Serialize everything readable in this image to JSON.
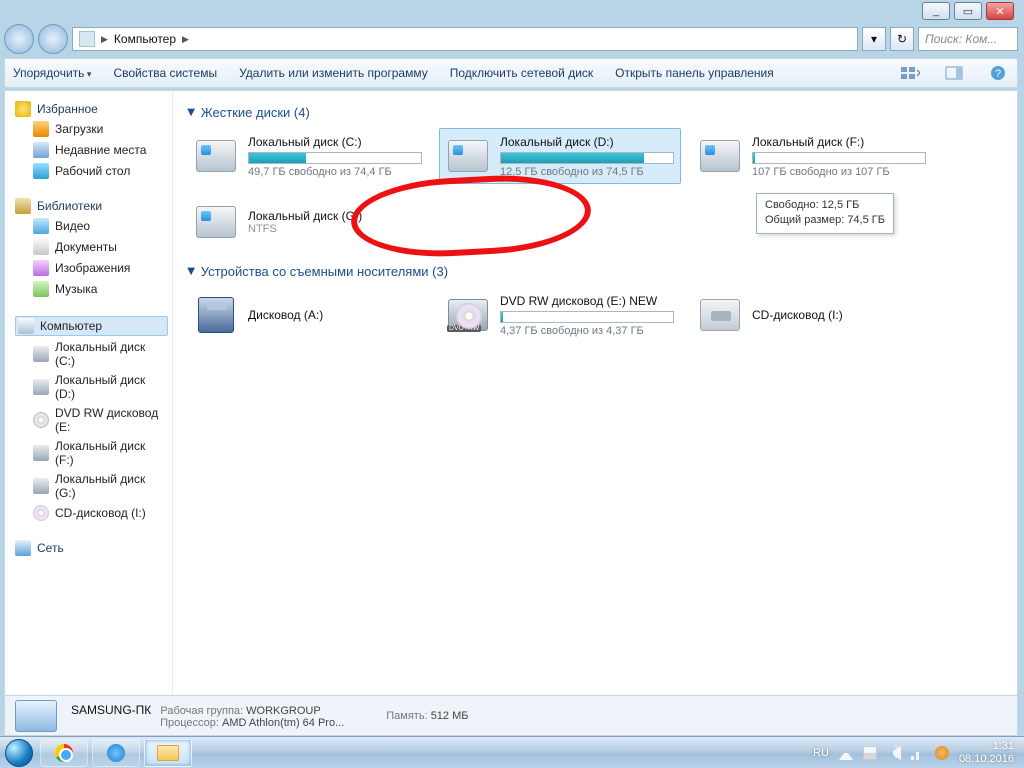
{
  "window": {
    "minimize": "_",
    "maximize": "▭",
    "close": "✕"
  },
  "address": {
    "crumb_root_icon": "computer-icon",
    "crumb_root": "Компьютер",
    "refresh": "↻",
    "dropdown": "▾",
    "search_placeholder": "Поиск: Ком..."
  },
  "toolbar": {
    "organize": "Упорядочить",
    "props": "Свойства системы",
    "uninstall": "Удалить или изменить программу",
    "map_drive": "Подключить сетевой диск",
    "control": "Открыть панель управления"
  },
  "sidebar": {
    "fav": "Избранное",
    "fav_items": [
      "Загрузки",
      "Недавние места",
      "Рабочий стол"
    ],
    "lib": "Библиотеки",
    "lib_items": [
      "Видео",
      "Документы",
      "Изображения",
      "Музыка"
    ],
    "comp": "Компьютер",
    "comp_items": [
      "Локальный диск (C:)",
      "Локальный диск (D:)",
      "DVD RW дисковод (E:",
      "Локальный диск (F:)",
      "Локальный диск (G:)",
      "CD-дисковод (I:)"
    ],
    "net": "Сеть"
  },
  "groups": {
    "hdd_title": "Жесткие диски (4)",
    "removable_title": "Устройства со съемными носителями (3)"
  },
  "drives": {
    "c": {
      "name": "Локальный диск (C:)",
      "free": "49,7 ГБ свободно из 74,4 ГБ",
      "pct": 33
    },
    "d": {
      "name": "Локальный диск (D:)",
      "free": "12,5 ГБ свободно из 74,5 ГБ",
      "pct": 83
    },
    "f": {
      "name": "Локальный диск (F:)",
      "free": "107 ГБ свободно из 107 ГБ",
      "pct": 1
    },
    "g": {
      "name": "Локальный диск (G:)",
      "sub": "NTFS"
    },
    "a": {
      "name": "Дисковод (A:)"
    },
    "e": {
      "name": "DVD RW дисковод (E:) NEW",
      "free": "4,37 ГБ свободно из 4,37 ГБ",
      "pct": 1,
      "badge": "DVD+RW"
    },
    "i": {
      "name": "CD-дисковод (I:)"
    }
  },
  "tooltip": {
    "line1": "Свободно: 12,5 ГБ",
    "line2": "Общий размер: 74,5 ГБ"
  },
  "details": {
    "name": "SAMSUNG-ПК",
    "wg_label": "Рабочая группа:",
    "wg_value": "WORKGROUP",
    "cpu_label": "Процессор:",
    "cpu_value": "AMD Athlon(tm) 64 Pro...",
    "mem_label": "Память:",
    "mem_value": "512 МБ"
  },
  "tray": {
    "lang": "RU",
    "time": "1:31",
    "date": "08.10.2016"
  }
}
